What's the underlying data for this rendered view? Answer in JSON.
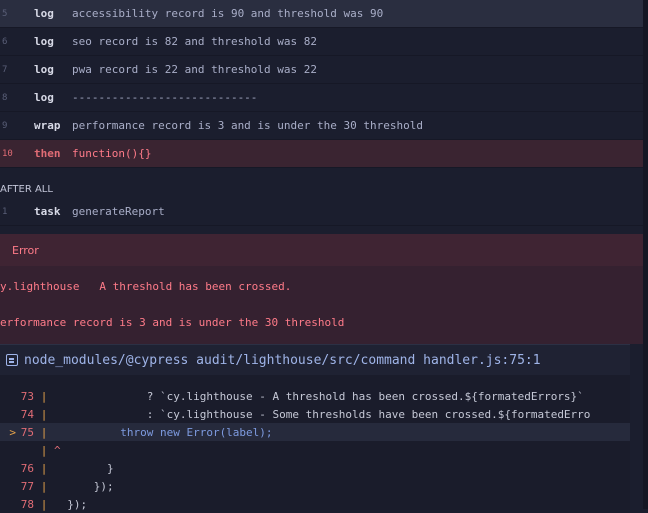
{
  "commands": [
    {
      "num": "5",
      "cmd": "log",
      "msg": "accessibility record is 90 and threshold was 90"
    },
    {
      "num": "6",
      "cmd": "log",
      "msg": "seo record is 82 and threshold was 82"
    },
    {
      "num": "7",
      "cmd": "log",
      "msg": "pwa record is 22 and threshold was 22"
    },
    {
      "num": "8",
      "cmd": "log",
      "msg": "----------------------------"
    },
    {
      "num": "9",
      "cmd": "wrap",
      "msg": "performance record is 3 and is under the 30 threshold"
    },
    {
      "num": "10",
      "cmd": "then",
      "msg": "function(){}"
    }
  ],
  "after_all": {
    "label": "AFTER ALL",
    "num": "1",
    "cmd": "task",
    "msg": "generateReport"
  },
  "error": {
    "title": "Error",
    "line1": "y.lighthouse   A threshold has been crossed.",
    "line2": "erformance record is 3 and is under the 30 threshold"
  },
  "code_frame": {
    "file": "node_modules/@cypress audit/lighthouse/src/command handler.js:75:1",
    "lines": [
      {
        "marker": "",
        "ln": "73",
        "bar": "|",
        "code": "              ? `cy.lighthouse - A threshold has been crossed.${formatedErrors}`"
      },
      {
        "marker": "",
        "ln": "74",
        "bar": "|",
        "code": "              : `cy.lighthouse - Some thresholds have been crossed.${formatedErro"
      },
      {
        "marker": ">",
        "ln": "75",
        "bar": "|",
        "code": "          throw new Error(label);"
      },
      {
        "marker": "",
        "ln": "",
        "bar": "|",
        "code": "^"
      },
      {
        "marker": "",
        "ln": "76",
        "bar": "|",
        "code": "        }"
      },
      {
        "marker": "",
        "ln": "77",
        "bar": "|",
        "code": "      });"
      },
      {
        "marker": "",
        "ln": "78",
        "bar": "|",
        "code": "  });"
      }
    ]
  },
  "colors": {
    "background": "#1b1e2e",
    "failure_row": "#3a2431",
    "error_text": "#ff7b89",
    "file_path": "#9fb4e8"
  }
}
